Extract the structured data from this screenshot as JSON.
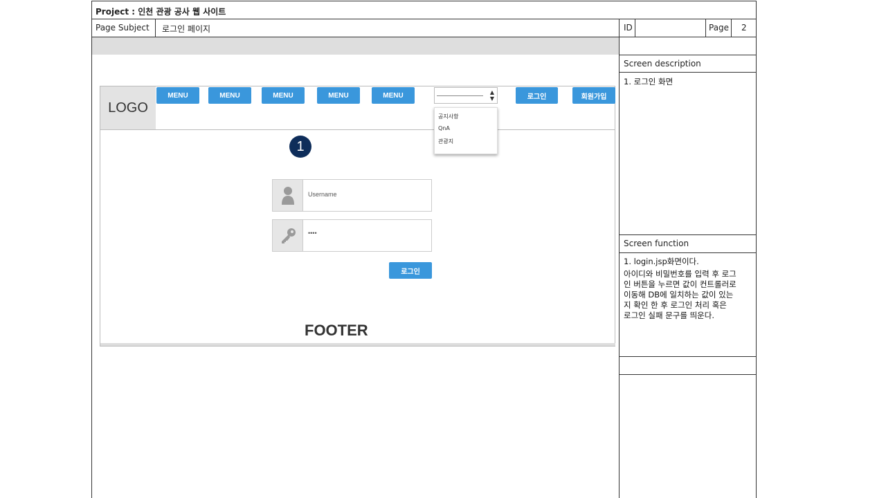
{
  "header": {
    "project_label": "Project : 인천 관광 공사 웹 사이트",
    "page_subject_label": "Page Subject",
    "page_subject_value": "로그인 페이지",
    "id_label": "ID",
    "id_value": "",
    "page_label": "Page",
    "page_value": "2"
  },
  "mockup": {
    "logo": "LOGO",
    "menus": [
      "MENU",
      "MENU",
      "MENU",
      "MENU",
      "MENU"
    ],
    "login_button": "로그인",
    "signup_button": "회원가입",
    "dropdown_items": [
      "공지사항",
      "QnA",
      "관광지"
    ],
    "badge": "1",
    "username_placeholder": "Username",
    "password_value": "••••",
    "submit_button": "로그인",
    "footer": "FOOTER"
  },
  "side": {
    "desc_title": "Screen description",
    "desc_text": "1. 로그인 화면",
    "func_title": "Screen function",
    "func_line1": "1. login.jsp화면이다.",
    "func_lines": [
      "아이디와 비밀번호를 입력 후 로그",
      "인 버튼을 누르면 값이 컨트롤러로",
      "이동해 DB에 일치하는 값이 있는",
      "지 확인 한 후 로그인 처리 혹은",
      "로그인 실패 문구를 띄운다."
    ]
  }
}
